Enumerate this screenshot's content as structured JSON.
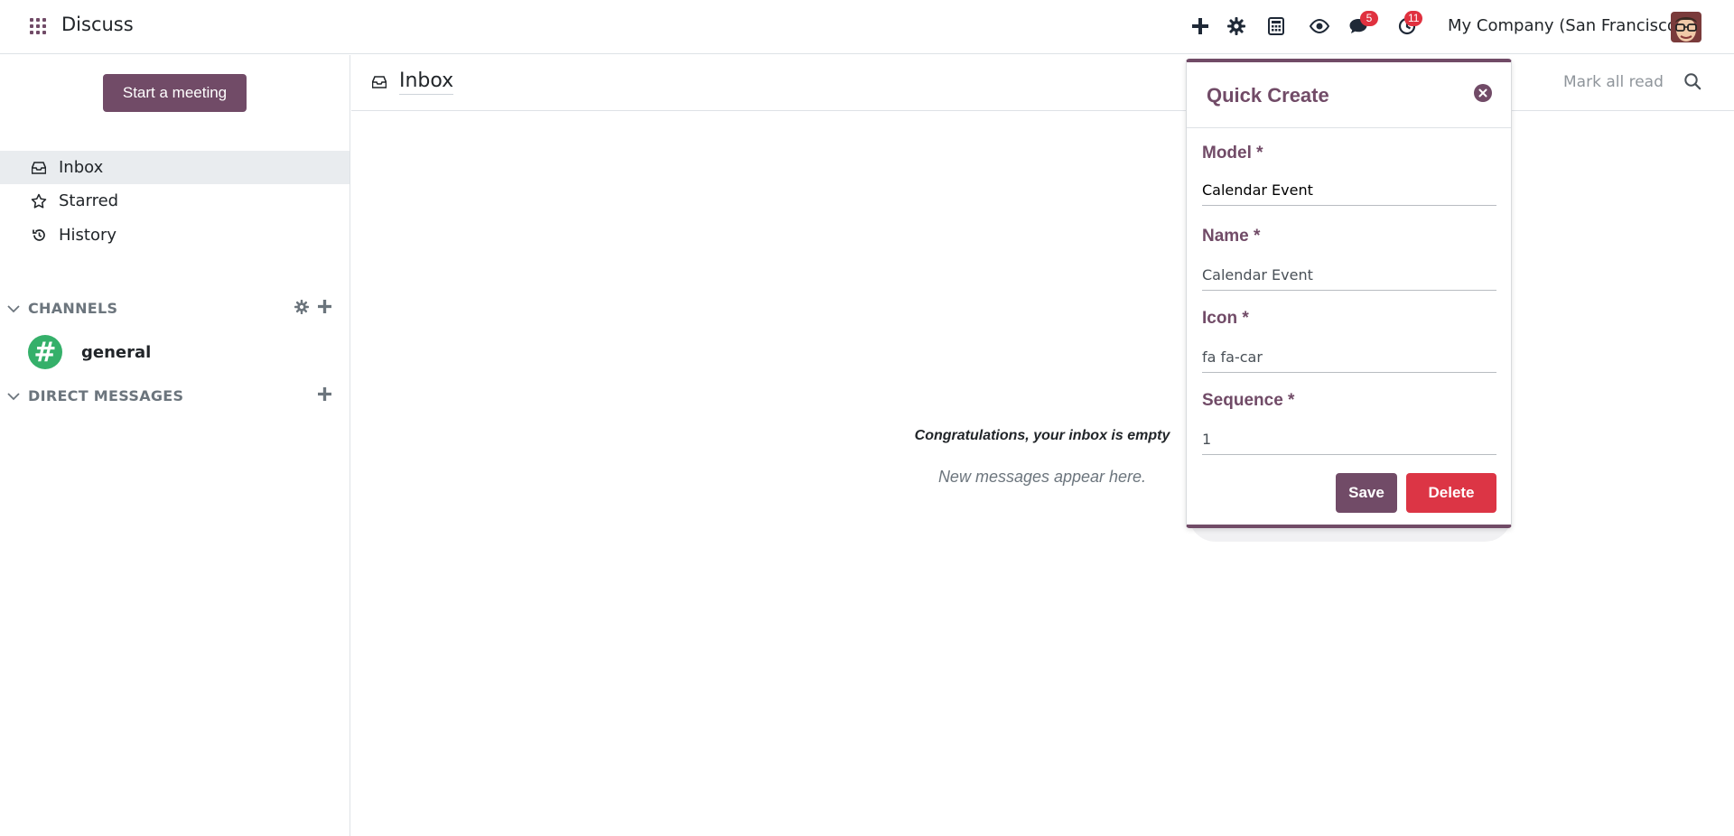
{
  "app": {
    "title": "Discuss"
  },
  "navbar": {
    "icons": [
      "plus-icon",
      "gear-icon",
      "calculator-icon",
      "eye-icon",
      "chat-icon",
      "clock-icon"
    ],
    "messages_badge": "5",
    "activities_badge": "11",
    "company": "My Company (San Francisco)"
  },
  "sidebar": {
    "start_meeting": "Start a meeting",
    "items": [
      {
        "label": "Inbox",
        "icon": "inbox-icon",
        "active": true
      },
      {
        "label": "Starred",
        "icon": "star-icon",
        "active": false
      },
      {
        "label": "History",
        "icon": "history-icon",
        "active": false
      }
    ],
    "channels_header": "CHANNELS",
    "channels": [
      {
        "name": "general",
        "symbol": "#"
      }
    ],
    "dm_header": "DIRECT MESSAGES"
  },
  "main": {
    "title": "Inbox",
    "mark_all_read": "Mark all read",
    "empty_title": "Congratulations, your inbox is empty",
    "empty_sub": "New messages appear here."
  },
  "quick_create": {
    "title": "Quick Create",
    "fields": [
      {
        "label": "Model *",
        "value": "Calendar Event"
      },
      {
        "label": "Name *",
        "value": "Calendar Event"
      },
      {
        "label": "Icon *",
        "value": "fa fa-car"
      },
      {
        "label": "Sequence *",
        "value": "1"
      }
    ],
    "save": "Save",
    "delete": "Delete"
  },
  "colors": {
    "brand": "#714b67",
    "danger": "#dc3545",
    "badge": "#e0313f",
    "channel": "#35b06a"
  }
}
